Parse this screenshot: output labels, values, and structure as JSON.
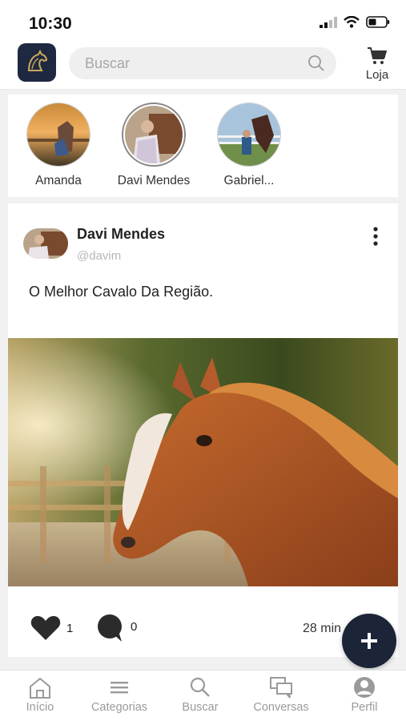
{
  "status_bar": {
    "time": "10:30"
  },
  "header": {
    "search_placeholder": "Buscar",
    "shop_label": "Loja"
  },
  "stories": [
    {
      "name": "Amanda"
    },
    {
      "name": "Davi Mendes"
    },
    {
      "name": "Gabriel..."
    }
  ],
  "post": {
    "author": "Davi Mendes",
    "handle": "@davim",
    "text": "O Melhor Cavalo Da Região.",
    "likes": "1",
    "comments": "0",
    "time": "28 min"
  },
  "bottom_nav": [
    {
      "label": "Início",
      "icon": "home-icon"
    },
    {
      "label": "Categorias",
      "icon": "menu-icon"
    },
    {
      "label": "Buscar",
      "icon": "search-icon"
    },
    {
      "label": "Conversas",
      "icon": "chat-icon"
    },
    {
      "label": "Perfil",
      "icon": "profile-icon"
    }
  ],
  "colors": {
    "brand_navy": "#1c2438",
    "inactive_nav": "#9a9a9a"
  }
}
